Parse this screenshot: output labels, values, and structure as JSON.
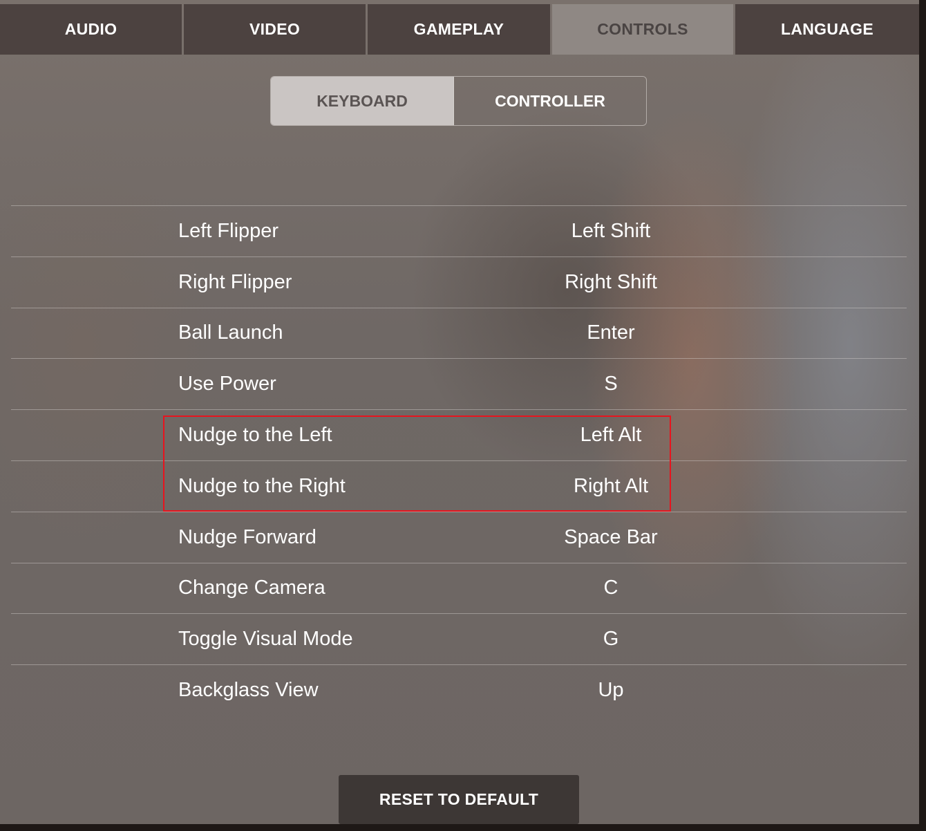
{
  "tabs": [
    {
      "label": "AUDIO",
      "active": false
    },
    {
      "label": "VIDEO",
      "active": false
    },
    {
      "label": "GAMEPLAY",
      "active": false
    },
    {
      "label": "CONTROLS",
      "active": true
    },
    {
      "label": "LANGUAGE",
      "active": false
    }
  ],
  "subtabs": [
    {
      "label": "KEYBOARD",
      "active": true
    },
    {
      "label": "CONTROLLER",
      "active": false
    }
  ],
  "bindings": [
    {
      "action": "Left Flipper",
      "key": "Left Shift"
    },
    {
      "action": "Right Flipper",
      "key": "Right Shift"
    },
    {
      "action": "Ball Launch",
      "key": "Enter"
    },
    {
      "action": "Use Power",
      "key": "S"
    },
    {
      "action": "Nudge to the Left",
      "key": "Left Alt"
    },
    {
      "action": "Nudge to the Right",
      "key": "Right Alt"
    },
    {
      "action": "Nudge Forward",
      "key": "Space Bar"
    },
    {
      "action": "Change Camera",
      "key": "C"
    },
    {
      "action": "Toggle Visual Mode",
      "key": "G"
    },
    {
      "action": "Backglass View",
      "key": "Up"
    }
  ],
  "reset_button": {
    "label": "RESET TO DEFAULT"
  },
  "colors": {
    "tab_bg": "#4c4240",
    "tab_active_bg": "#8f8884",
    "highlight_border": "#e8141e",
    "reset_bg": "#3d3735"
  }
}
